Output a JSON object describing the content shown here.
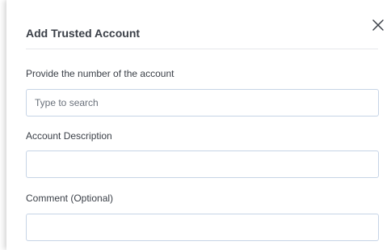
{
  "dialog": {
    "title": "Add Trusted Account",
    "close_icon": "close-icon"
  },
  "form": {
    "account_number": {
      "label": "Provide the number of the account",
      "placeholder": "Type to search",
      "value": ""
    },
    "account_description": {
      "label": "Account Description",
      "value": ""
    },
    "comment": {
      "label": "Comment (Optional)",
      "value": ""
    }
  },
  "colors": {
    "text": "#3a3f47",
    "input_border": "#c6d4e6",
    "divider": "#e6e8eb"
  }
}
